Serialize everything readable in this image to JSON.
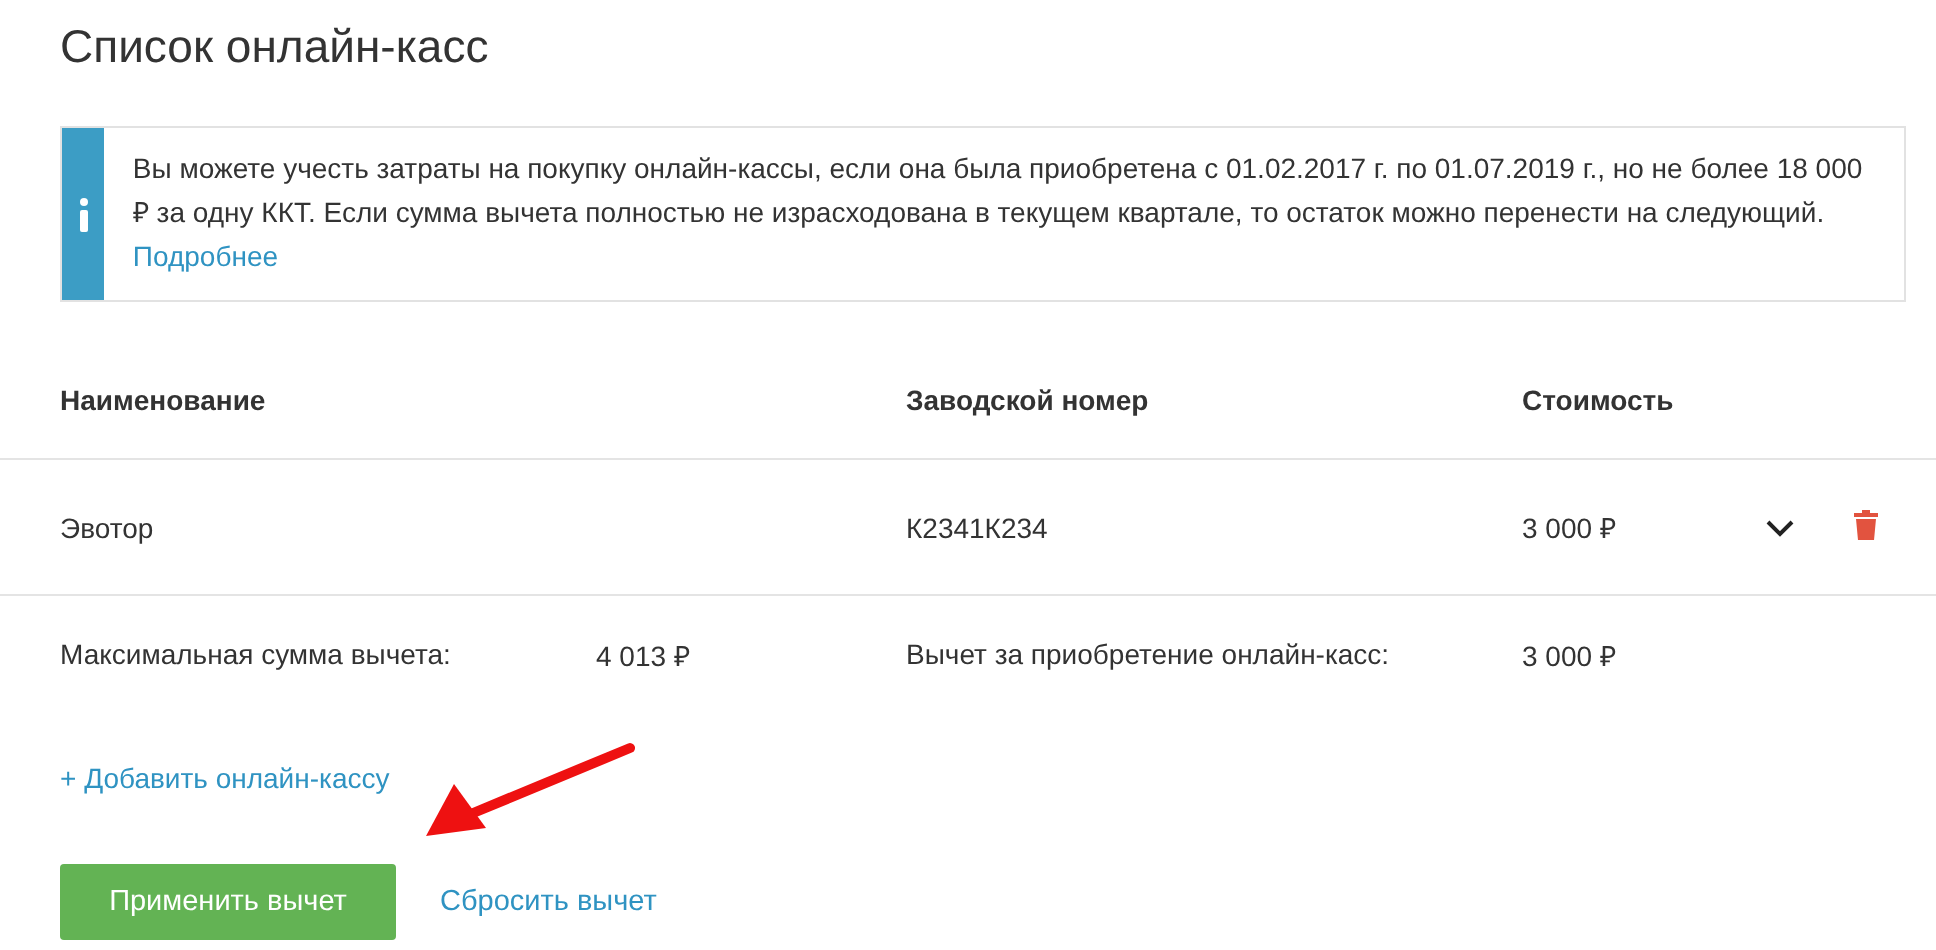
{
  "title": "Список онлайн-касс",
  "notice": {
    "text": "Вы можете учесть затраты на покупку онлайн-кассы, если она была приобретена с 01.02.2017 г. по 01.07.2019 г., но не более 18 000 ₽ за одну ККТ. Если сумма вычета полностью не израсходована в текущем квартале, то остаток можно перенести на следующий.",
    "link": "Подробнее"
  },
  "table": {
    "columns": [
      "Наименование",
      "Заводской номер",
      "Стоимость"
    ],
    "rows": [
      {
        "name": "Эвотор",
        "serial": "К2341К234",
        "cost": "3 000 ₽",
        "expanded": false
      }
    ]
  },
  "summary": [
    {
      "label": "Максимальная сумма вычета:",
      "value": "4 013 ₽"
    },
    {
      "label": "Вычет за приобретение онлайн-касс:",
      "value": "3 000 ₽"
    }
  ],
  "add_link": "+ Добавить онлайн-кассу",
  "buttons": [
    {
      "label": "Применить вычет",
      "kind": "primary"
    },
    {
      "label": "Сбросить вычет",
      "kind": "link"
    }
  ]
}
